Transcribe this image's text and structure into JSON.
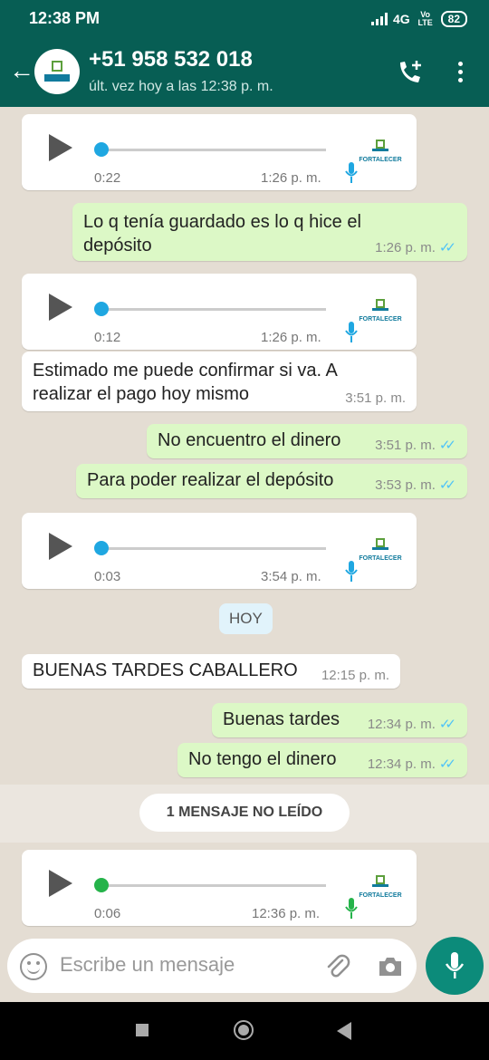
{
  "status_bar": {
    "time": "12:38 PM",
    "network": "4G",
    "volte": "Vo LTE",
    "battery": "82"
  },
  "header": {
    "contact_name": "+51 958 532 018",
    "last_seen": "últ. vez hoy a las 12:38 p. m."
  },
  "colors": {
    "header": "#075e54",
    "outgoing": "#dcf8c6",
    "incoming": "#ffffff",
    "tick_blue": "#4fc3f7",
    "accent": "#0c8b7a",
    "knob_blue": "#1fa7e1",
    "knob_green": "#25b34a"
  },
  "messages": [
    {
      "type": "voice",
      "direction": "in",
      "duration": "0:22",
      "time": "1:26 p. m.",
      "logo_text": "FORTALECER"
    },
    {
      "type": "text",
      "direction": "out",
      "text": "Lo q tenía guardado es lo q hice el depósito",
      "time": "1:26 p. m."
    },
    {
      "type": "voice",
      "direction": "in",
      "duration": "0:12",
      "time": "1:26 p. m.",
      "logo_text": "FORTALECER"
    },
    {
      "type": "text",
      "direction": "in",
      "text": "Estimado me puede confirmar si va. A realizar el pago hoy mismo",
      "time": "3:51 p. m."
    },
    {
      "type": "text",
      "direction": "out",
      "text": "No encuentro el dinero",
      "time": "3:51 p. m."
    },
    {
      "type": "text",
      "direction": "out",
      "text": "Para poder realizar el depósito",
      "time": "3:53 p. m."
    },
    {
      "type": "voice",
      "direction": "in",
      "duration": "0:03",
      "time": "3:54 p. m.",
      "logo_text": "FORTALECER"
    },
    {
      "type": "date",
      "text": "HOY"
    },
    {
      "type": "text",
      "direction": "in",
      "text": "BUENAS TARDES CABALLERO",
      "time": "12:15 p. m."
    },
    {
      "type": "text",
      "direction": "out",
      "text": "Buenas tardes",
      "time": "12:34 p. m."
    },
    {
      "type": "text",
      "direction": "out",
      "text": "No tengo el dinero",
      "time": "12:34 p. m."
    },
    {
      "type": "unread",
      "text": "1 MENSAJE NO LEÍDO"
    },
    {
      "type": "voice",
      "direction": "in",
      "duration": "0:06",
      "time": "12:36 p. m.",
      "logo_text": "FORTALECER"
    }
  ],
  "input": {
    "placeholder": "Escribe un mensaje"
  }
}
